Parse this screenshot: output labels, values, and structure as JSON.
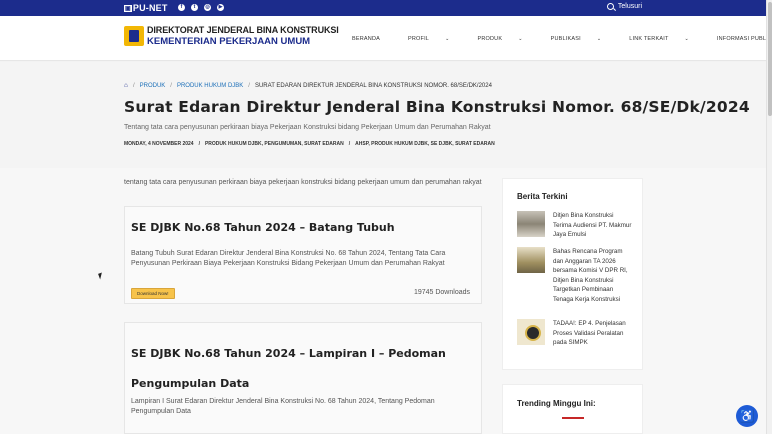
{
  "topbar": {
    "brand": "PU-NET",
    "search_label": "Telusuri",
    "social_icons": [
      "facebook-icon",
      "twitter-icon",
      "instagram-icon",
      "youtube-icon"
    ]
  },
  "logo": {
    "line1": "DIREKTORAT JENDERAL BINA KONSTRUKSI",
    "line2": "KEMENTERIAN PEKERJAAN UMUM"
  },
  "nav": {
    "items": [
      "BERANDA",
      "PROFIL",
      "PRODUK",
      "PUBLIKASI",
      "LINK TERKAIT",
      "INFORMASI PUBLIK"
    ]
  },
  "breadcrumb": {
    "items": [
      "PRODUK",
      "PRODUK HUKUM DJBK"
    ],
    "current": "SURAT EDARAN DIREKTUR JENDERAL BINA KONSTRUKSI NOMOR. 68/SE/DK/2024"
  },
  "page": {
    "title": "Surat Edaran Direktur Jenderal Bina Konstruksi Nomor. 68/SE/Dk/2024",
    "description": "Tentang tata cara penyusunan perkiraan biaya Pekerjaan Konstruksi bidang Pekerjaan Umum dan Perumahan Rakyat",
    "date": "MONDAY, 4 NOVEMBER 2024",
    "categories": "PRODUK HUKUM DJBK, PENGUMUMAN, SURAT EDARAN",
    "tags": "AHSP, PRODUK HUKUM DJBK, SE DJBK, SURAT EDARAN"
  },
  "intro": "tentang tata cara penyusunan perkiraan biaya pekerjaan konstruksi bidang pekerjaan umum dan perumahan rakyat",
  "downloads": [
    {
      "title": "SE DJBK No.68 Tahun 2024 – Batang Tubuh",
      "description": "Batang Tubuh Surat Edaran Direktur Jenderal Bina Konstruksi No. 68 Tahun 2024, Tentang Tata Cara Penyusunan Perkiraan Biaya Pekerjaan Konstruksi Bidang Pekerjaan Umum dan Perumahan Rakyat",
      "button": "Download Now!",
      "count": "19745 Downloads"
    },
    {
      "title": "SE DJBK No.68 Tahun 2024 – Lampiran I – Pedoman Pengumpulan Data",
      "description": "Lampiran I Surat Edaran Direktur Jenderal Bina Konstruksi No. 68 Tahun 2024, Tentang Pedoman Pengumpulan Data"
    }
  ],
  "sidebar": {
    "heading": "Berita Terkini",
    "news": [
      "Ditjen Bina Konstruksi Terima Audiensi PT. Makmur Jaya Emulsi",
      "Bahas Rencana Program dan Anggaran TA 2026 bersama Komisi V DPR RI, Ditjen Bina Konstruksi Targetkan Pembinaan Tenaga Kerja Konstruksi",
      "TADAA!: EP 4. Penjelasan Proses Validasi Peralatan pada SIMPK"
    ],
    "trending_heading": "Trending Minggu Ini:"
  }
}
